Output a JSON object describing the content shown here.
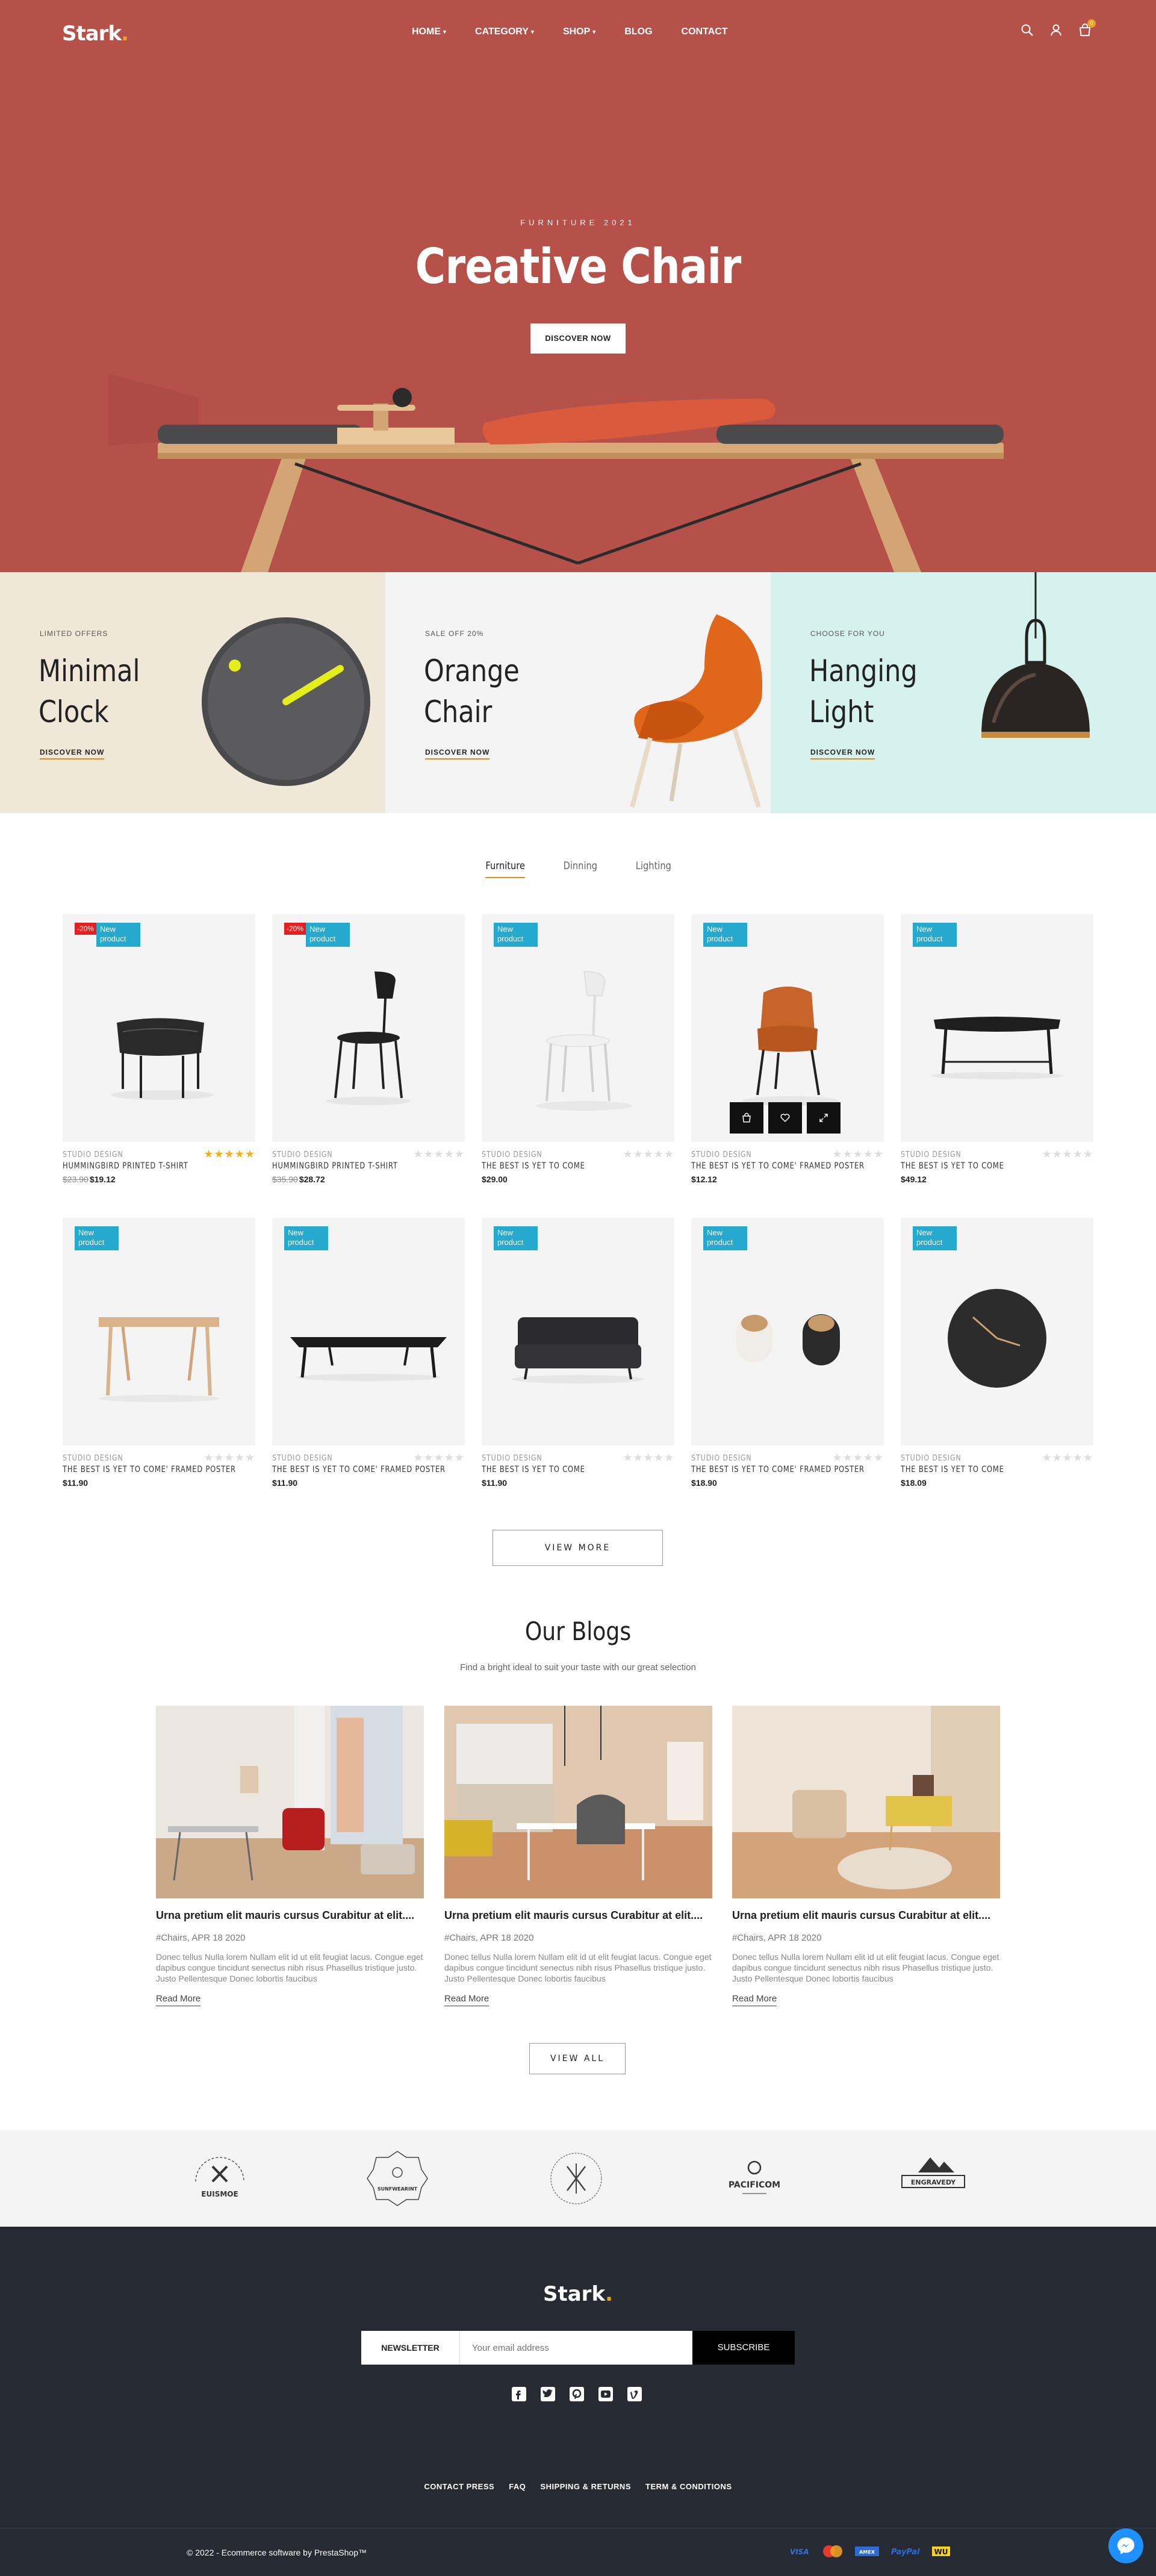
{
  "header": {
    "logo": "Stark",
    "nav": [
      {
        "label": "HOME",
        "caret": true
      },
      {
        "label": "CATEGORY",
        "caret": true
      },
      {
        "label": "SHOP",
        "caret": true
      },
      {
        "label": "BLOG",
        "caret": false
      },
      {
        "label": "CONTACT",
        "caret": false
      }
    ],
    "cart_count": "0",
    "icons": [
      "search-icon",
      "user-icon",
      "cart-icon"
    ]
  },
  "hero": {
    "kicker": "FURNITURE 2021",
    "title": "Creative Chair",
    "button": "DISCOVER NOW",
    "background": "#b6514a"
  },
  "promos": [
    {
      "kicker": "LIMITED OFFERS",
      "title": "Minimal Clock",
      "link": "DISCOVER NOW",
      "background": "#efe7d7"
    },
    {
      "kicker": "SALE OFF 20%",
      "title": "Orange Chair",
      "link": "DISCOVER NOW",
      "background": "#f4f4f4"
    },
    {
      "kicker": "CHOOSE FOR YOU",
      "title": "Hanging Light",
      "link": "DISCOVER NOW",
      "background": "#d6f2ee"
    }
  ],
  "tabs": [
    "Furniture",
    "Dinning",
    "Lighting"
  ],
  "products": [
    {
      "brand": "STUDIO DESIGN",
      "name": "HUMMINGBIRD PRINTED T-SHIRT",
      "old_price": "$23.90",
      "price": "$19.12",
      "sale": "-20%",
      "new": "New product",
      "rating": 5
    },
    {
      "brand": "STUDIO DESIGN",
      "name": "HUMMINGBIRD PRINTED T-SHIRT",
      "old_price": "$35.90",
      "price": "$28.72",
      "sale": "-20%",
      "new": "New product",
      "rating": 0
    },
    {
      "brand": "STUDIO DESIGN",
      "name": "THE BEST IS YET TO COME",
      "old_price": "",
      "price": "$29.00",
      "sale": "",
      "new": "New product",
      "rating": 0
    },
    {
      "brand": "STUDIO DESIGN",
      "name": "THE BEST IS YET TO COME' FRAMED POSTER",
      "old_price": "",
      "price": "$12.12",
      "sale": "",
      "new": "New product",
      "rating": 0
    },
    {
      "brand": "STUDIO DESIGN",
      "name": "THE BEST IS YET TO COME",
      "old_price": "",
      "price": "$49.12",
      "sale": "",
      "new": "New product",
      "rating": 0
    },
    {
      "brand": "STUDIO DESIGN",
      "name": "THE BEST IS YET TO COME' FRAMED POSTER",
      "old_price": "",
      "price": "$11.90",
      "sale": "",
      "new": "New product",
      "rating": 0
    },
    {
      "brand": "STUDIO DESIGN",
      "name": "THE BEST IS YET TO COME' FRAMED POSTER",
      "old_price": "",
      "price": "$11.90",
      "sale": "",
      "new": "New product",
      "rating": 0
    },
    {
      "brand": "STUDIO DESIGN",
      "name": "THE BEST IS YET TO COME",
      "old_price": "",
      "price": "$11.90",
      "sale": "",
      "new": "New product",
      "rating": 0
    },
    {
      "brand": "STUDIO DESIGN",
      "name": "THE BEST IS YET TO COME' FRAMED POSTER",
      "old_price": "",
      "price": "$18.90",
      "sale": "",
      "new": "New product",
      "rating": 0
    },
    {
      "brand": "STUDIO DESIGN",
      "name": "THE BEST IS YET TO COME",
      "old_price": "",
      "price": "$18.09",
      "sale": "",
      "new": "New product",
      "rating": 0
    }
  ],
  "view_more": "VIEW MORE",
  "blogs": {
    "title": "Our Blogs",
    "subtitle": "Find a bright ideal to suit your taste with our great selection",
    "posts": [
      {
        "title": "Urna pretium elit mauris cursus Curabitur at elit....",
        "meta": "#Chairs, APR 18 2020",
        "excerpt": "Donec tellus Nulla lorem Nullam elit id ut elit feugiat lacus. Congue eget dapibus congue tincidunt senectus nibh risus Phasellus tristique justo. Justo Pellentesque Donec lobortis faucibus",
        "link": "Read More"
      },
      {
        "title": "Urna pretium elit mauris cursus Curabitur at elit....",
        "meta": "#Chairs, APR 18 2020",
        "excerpt": "Donec tellus Nulla lorem Nullam elit id ut elit feugiat lacus. Congue eget dapibus congue tincidunt senectus nibh risus Phasellus tristique justo. Justo Pellentesque Donec lobortis faucibus",
        "link": "Read More"
      },
      {
        "title": "Urna pretium elit mauris cursus Curabitur at elit....",
        "meta": "#Chairs, APR 18 2020",
        "excerpt": "Donec tellus Nulla lorem Nullam elit id ut elit feugiat lacus. Congue eget dapibus congue tincidunt senectus nibh risus Phasellus tristique justo. Justo Pellentesque Donec lobortis faucibus",
        "link": "Read More"
      }
    ],
    "view_all": "VIEW ALL"
  },
  "brands": [
    "EUISMOE",
    "SUNFWEARINT",
    "",
    "PACIFICOM",
    "ENGRAVEDY"
  ],
  "footer": {
    "logo": "Stark",
    "newsletter_label": "NEWSLETTER",
    "newsletter_placeholder": "Your email address",
    "subscribe": "SUBSCRIBE",
    "socials": [
      "facebook-icon",
      "twitter-icon",
      "pinterest-icon",
      "youtube-icon",
      "vimeo-icon"
    ],
    "links": [
      "CONTACT PRESS",
      "FAQ",
      "SHIPPING & RETURNS",
      "TERM & CONDITIONS"
    ],
    "copyright": "© 2022 - Ecommerce software by PrestaShop™",
    "payments": [
      "visa-icon",
      "mastercard-icon",
      "amex-icon",
      "paypal-icon",
      "western-union-icon"
    ]
  }
}
